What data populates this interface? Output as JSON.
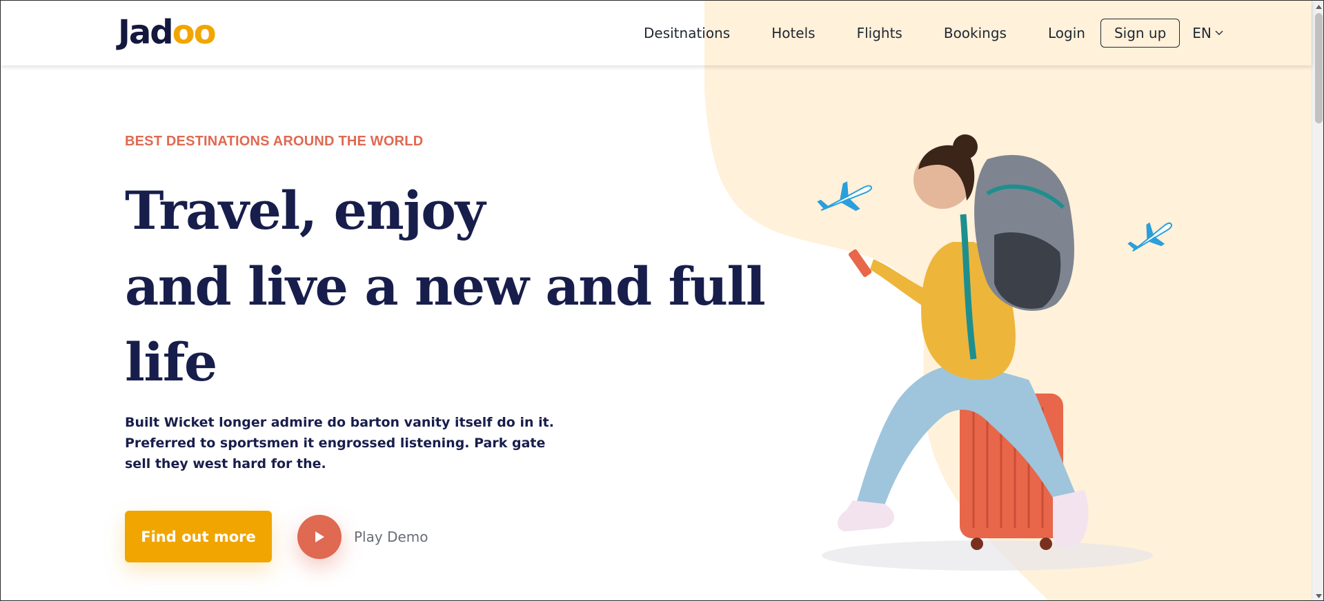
{
  "brand": {
    "name_prefix": "Jad",
    "name_suffix": "oo"
  },
  "nav": {
    "links": [
      "Desitnations",
      "Hotels",
      "Flights",
      "Bookings"
    ],
    "login": "Login",
    "signup": "Sign up",
    "language": "EN"
  },
  "hero": {
    "eyebrow": "BEST DESTINATIONS AROUND THE WORLD",
    "headline_lines": [
      "Travel, enjoy",
      "and live a new and full",
      "life"
    ],
    "description_lines": [
      "Built Wicket longer admire do barton vanity itself do in it.",
      "Preferred to sportsmen it engrossed listening. Park gate",
      "sell they west hard for the."
    ],
    "cta_label": "Find out more",
    "play_label": "Play Demo"
  },
  "colors": {
    "accent_yellow": "#F1A501",
    "accent_orange": "#DF6951",
    "heading_navy": "#181E4B",
    "blob_cream": "#FFF1DA"
  },
  "icons": {
    "play": "play-icon",
    "chevron": "chevron-down-icon",
    "plane": "airplane-icon"
  }
}
